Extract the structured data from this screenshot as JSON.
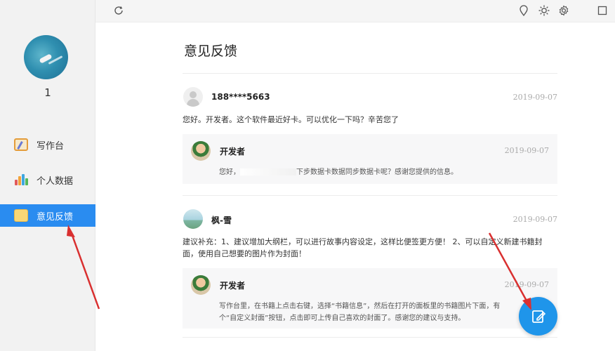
{
  "sidebar": {
    "username": "1",
    "items": [
      {
        "label": "写作台",
        "icon": "writing-pad-icon"
      },
      {
        "label": "个人数据",
        "icon": "bar-chart-icon"
      },
      {
        "label": "意见反馈",
        "icon": "folder-icon",
        "active": true
      }
    ]
  },
  "topbar": {
    "icons": [
      "refresh-icon",
      "location-pin-icon",
      "sun-icon",
      "gear-icon",
      "maximize-icon"
    ]
  },
  "main": {
    "title": "意见反馈",
    "feedback": [
      {
        "user": "188****5663",
        "date": "2019-09-07",
        "body": "您好。开发者。这个软件最近好卡。可以优化一下吗？辛苦您了",
        "reply": {
          "author": "开发者",
          "date": "2019-09-07",
          "text_a": "您好，",
          "text_b": "下步数据卡数据同步数据卡呢？感谢您提供的信息。"
        }
      },
      {
        "user": "枫-雪",
        "date": "2019-09-07",
        "body": "建议补充：1、建议增加大纲栏，可以进行故事内容设定，这样比便签更方便！ 2、可以自定义新建书籍封面，使用自己想要的图片作为封面！",
        "reply": {
          "author": "开发者",
          "date": "2019-09-07",
          "text": "写作台里，在书籍上点击右键，选择“书籍信息”，然后在打开的面板里的书籍图片下面，有个“自定义封面”按钮，点击即可上传自己喜欢的封面了。感谢您的建议与支持。"
        }
      }
    ]
  },
  "fab": {
    "icon": "compose-icon"
  },
  "colors": {
    "accent": "#2a8cf0",
    "fab": "#1f95ea",
    "arrow": "#d93030"
  }
}
